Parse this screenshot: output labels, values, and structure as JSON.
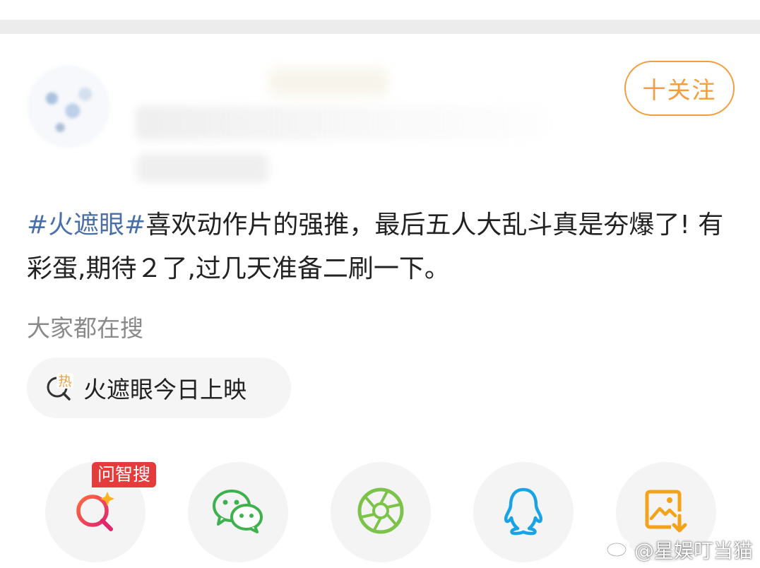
{
  "header": {
    "follow_label": "十关注"
  },
  "post": {
    "topic": "#火遮眼#",
    "body": "喜欢动作片的强推，最后五人大乱斗真是夯爆了! 有彩蛋,期待２了,过几天准备二刷一下。"
  },
  "search": {
    "heading": "大家都在搜",
    "hot_icon_text": "热",
    "hot_item": "火遮眼今日上映"
  },
  "share": {
    "badge": "问智搜",
    "items": [
      {
        "icon": "ai-search-icon"
      },
      {
        "icon": "wechat-icon"
      },
      {
        "icon": "moments-icon"
      },
      {
        "icon": "qq-icon"
      },
      {
        "icon": "save-image-icon"
      }
    ]
  },
  "watermark": {
    "text": "@星娱叮当猫"
  },
  "colors": {
    "accent_orange": "#f39d3c",
    "topic_blue": "#4a6ea8",
    "badge_red": "#e63b3b"
  }
}
